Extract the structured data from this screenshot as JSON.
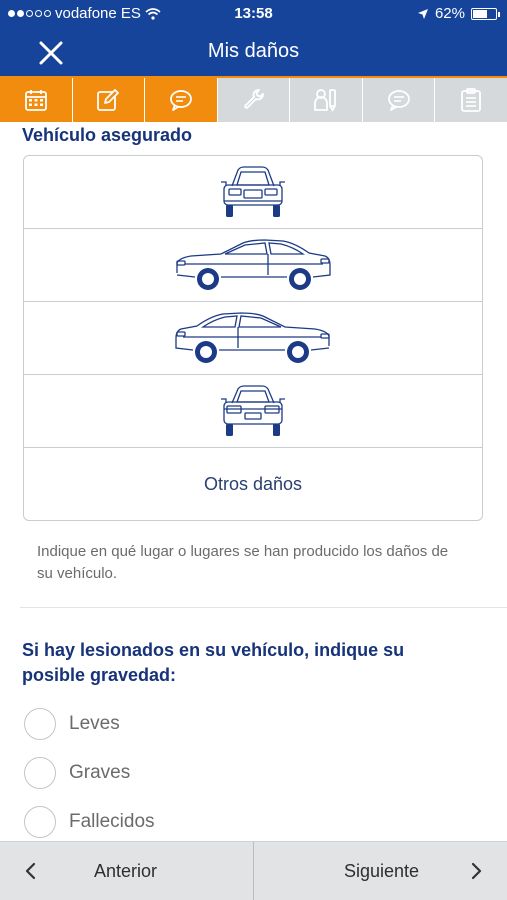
{
  "status_bar": {
    "carrier": "vodafone ES",
    "time": "13:58",
    "battery": "62%",
    "battery_level": 0.62,
    "signal_dots": [
      true,
      true,
      false,
      false,
      false
    ]
  },
  "nav": {
    "title": "Mis daños",
    "close_icon": "close-icon"
  },
  "tabs": [
    {
      "icon": "calendar-icon",
      "active": true
    },
    {
      "icon": "edit-icon",
      "active": true
    },
    {
      "icon": "chat-icon",
      "active": true
    },
    {
      "icon": "wrench-icon",
      "active": false
    },
    {
      "icon": "people-icon",
      "active": false
    },
    {
      "icon": "comment-icon",
      "active": false
    },
    {
      "icon": "clipboard-icon",
      "active": false
    }
  ],
  "vehicle_section": {
    "title": "Vehículo asegurado",
    "views": [
      "car-front-view",
      "car-left-side-view",
      "car-right-side-view",
      "car-rear-view"
    ],
    "others_label": "Otros daños",
    "hint": "Indique en qué lugar o lugares se han producido los daños de su vehículo."
  },
  "injuries_section": {
    "title": "Si hay lesionados en su vehículo, indique su posible gravedad:",
    "options": [
      "Leves",
      "Graves",
      "Fallecidos"
    ]
  },
  "footer": {
    "prev_label": "Anterior",
    "next_label": "Siguiente"
  },
  "colors": {
    "brand_blue": "#17449b",
    "accent_orange": "#f28c0f",
    "heading_navy": "#17337a"
  }
}
